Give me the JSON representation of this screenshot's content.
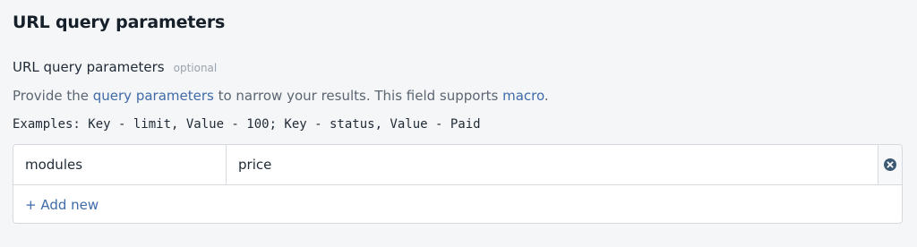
{
  "section": {
    "title": "URL query parameters"
  },
  "field": {
    "label": "URL query parameters",
    "optional": "optional",
    "description_prefix": "Provide the ",
    "description_link1": "query parameters",
    "description_middle": " to narrow your results. This field supports ",
    "description_link2": "macro",
    "description_suffix": ".",
    "examples": "Examples: Key - limit, Value - 100; Key - status, Value - Paid"
  },
  "params": {
    "rows": [
      {
        "key": "modules",
        "value": "price",
        "remove_icon": "close-circle-icon"
      }
    ],
    "add_new_label": "+ Add new"
  },
  "colors": {
    "accent": "#3f6ba8",
    "icon": "#3d5a73",
    "border": "#d6dadf",
    "background": "#f5f6f7"
  }
}
